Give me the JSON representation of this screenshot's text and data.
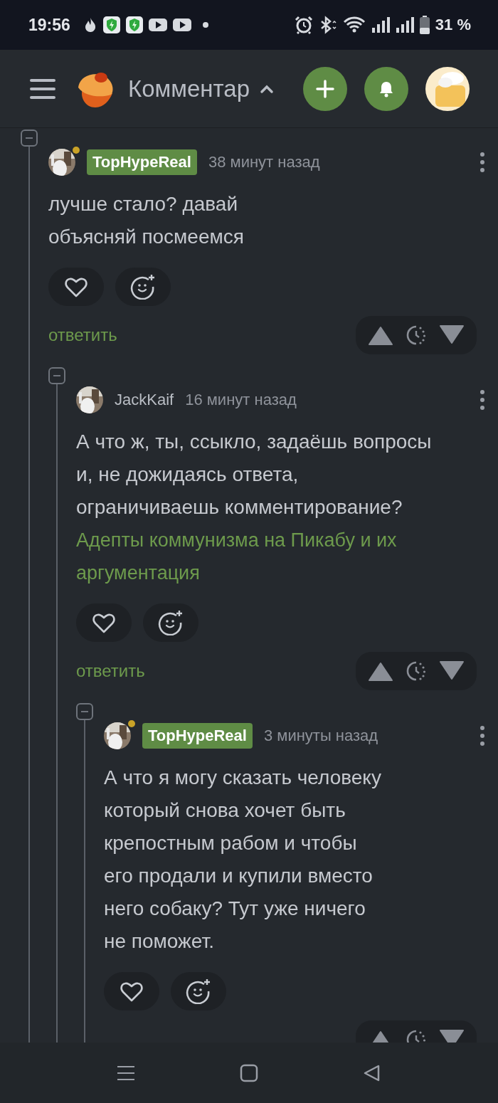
{
  "status_bar": {
    "time": "19:56",
    "battery": "31 %"
  },
  "header": {
    "title": "Комментар"
  },
  "comments": [
    {
      "author": "TopHypeReal",
      "highlighted": true,
      "online": true,
      "time": "38 минут назад",
      "text": "лучше стало? давай\nобъясняй посмеемся",
      "reply": "ответить",
      "children": [
        {
          "author": "JackKaif",
          "highlighted": false,
          "online": false,
          "time": "16 минут назад",
          "text": "А что ж, ты, ссыкло, задаёшь вопросы\nи, не дожидаясь ответа,\nограничиваешь комментирование?",
          "link": "Адепты коммунизма на Пикабу и их аргументация",
          "reply": "ответить",
          "children": [
            {
              "author": "TopHypeReal",
              "highlighted": true,
              "online": true,
              "time": "3 минуты назад",
              "text": "А что я могу сказать человеку\nкоторый снова хочет быть\nкрепостным рабом и чтобы\nего продали и купили вместо\nнего собаку? Тут уже ничего\nне поможет."
            }
          ]
        }
      ]
    }
  ]
}
